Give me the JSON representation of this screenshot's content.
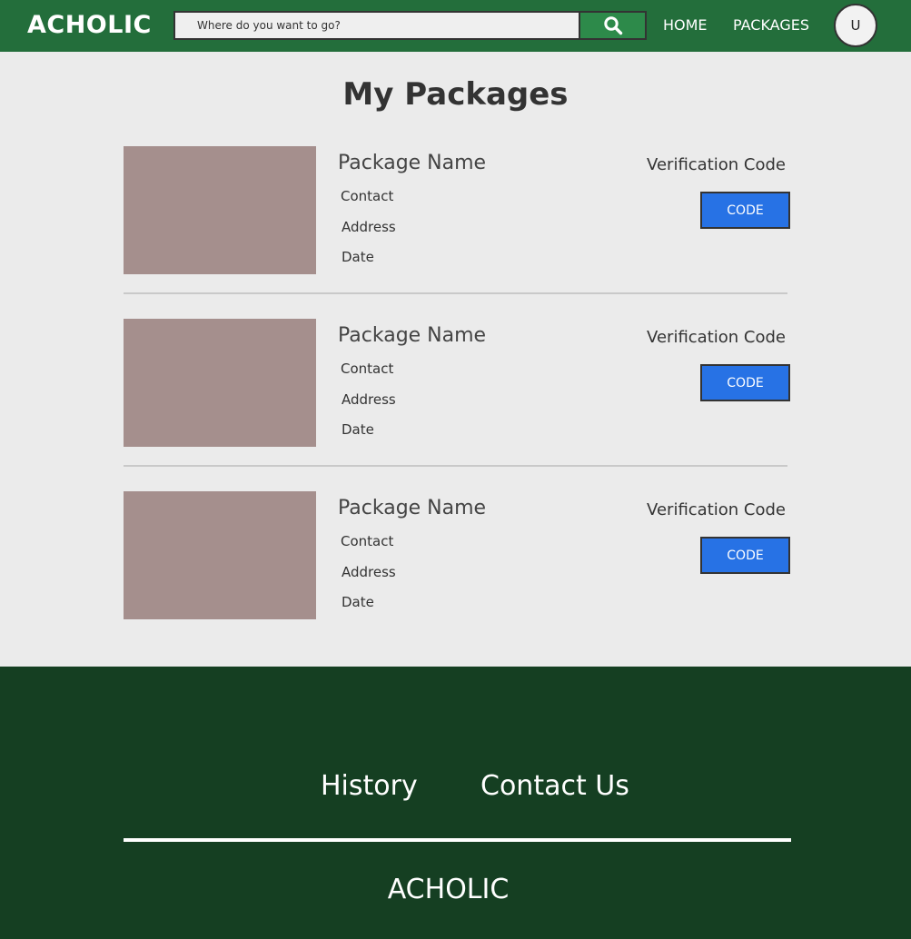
{
  "header": {
    "logo": "ACHOLIC",
    "search": {
      "placeholder": "Where do you want to go?"
    },
    "nav": {
      "home": "HOME",
      "packages": "PACKAGES"
    },
    "avatar_initial": "U"
  },
  "main": {
    "title": "My Packages",
    "packages": [
      {
        "name": "Package Name",
        "contact": "Contact",
        "address": "Address",
        "date": "Date",
        "verification_label": "Verification Code",
        "code_button": "CODE"
      },
      {
        "name": "Package Name",
        "contact": "Contact",
        "address": "Address",
        "date": "Date",
        "verification_label": "Verification Code",
        "code_button": "CODE"
      },
      {
        "name": "Package Name",
        "contact": "Contact",
        "address": "Address",
        "date": "Date",
        "verification_label": "Verification Code",
        "code_button": "CODE"
      }
    ]
  },
  "footer": {
    "links": {
      "history": "History",
      "contact_us": "Contact Us"
    },
    "logo": "ACHOLIC"
  },
  "colors": {
    "header_bg": "#236e3b",
    "search_button": "#2d8a4a",
    "page_bg": "#ebebeb",
    "image_placeholder": "#a58f8d",
    "code_button": "#2772e5",
    "footer_bg": "#153f22"
  },
  "icons": {
    "search": "search-icon"
  }
}
